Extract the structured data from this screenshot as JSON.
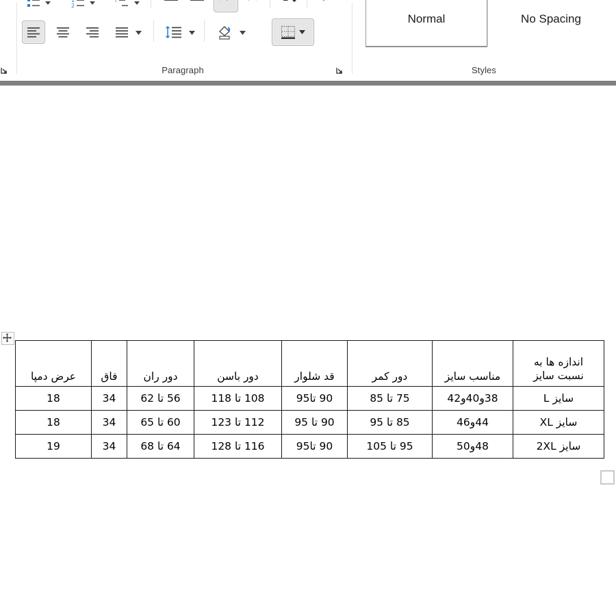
{
  "app": {
    "name": "Microsoft Word",
    "document_area_background": "#808080",
    "page_background": "#ffffff"
  },
  "ribbon": {
    "groups": [
      {
        "id": "paragraph",
        "label": "Paragraph",
        "dialog_launcher_name": "paragraph-dialog-launcher",
        "controls_row1": [
          {
            "id": "bullets",
            "name": "bullets-icon",
            "tooltip": "Bullets"
          },
          {
            "id": "numbering",
            "name": "numbering-icon",
            "tooltip": "Numbering"
          },
          {
            "id": "multilevel",
            "name": "multilevel-list-icon",
            "tooltip": "Multilevel List"
          },
          {
            "id": "decrease-indent",
            "name": "decrease-indent-icon",
            "tooltip": "Decrease Indent"
          },
          {
            "id": "increase-indent",
            "name": "increase-indent-icon",
            "tooltip": "Increase Indent"
          },
          {
            "id": "rtl-text",
            "name": "right-to-left-text-direction-icon",
            "tooltip": "Right-to-Left Text Direction",
            "selected": true
          },
          {
            "id": "ltr-text",
            "name": "left-to-right-text-direction-icon",
            "tooltip": "Left-to-Right Text Direction"
          },
          {
            "id": "sort",
            "name": "sort-icon",
            "tooltip": "Sort"
          },
          {
            "id": "show-marks",
            "name": "show-formatting-marks-icon",
            "tooltip": "Show/Hide ¶"
          }
        ],
        "controls_row2": [
          {
            "id": "align-left",
            "name": "align-left-icon",
            "tooltip": "Align Left",
            "selected": true
          },
          {
            "id": "align-center",
            "name": "align-center-icon",
            "tooltip": "Center"
          },
          {
            "id": "align-right",
            "name": "align-right-icon",
            "tooltip": "Align Right"
          },
          {
            "id": "justify",
            "name": "justify-icon",
            "tooltip": "Justify"
          },
          {
            "id": "line-spacing",
            "name": "line-spacing-icon",
            "tooltip": "Line and Paragraph Spacing"
          },
          {
            "id": "shading",
            "name": "shading-icon",
            "tooltip": "Shading"
          },
          {
            "id": "borders",
            "name": "borders-icon",
            "tooltip": "Borders"
          }
        ]
      },
      {
        "id": "styles",
        "label": "Styles",
        "dialog_launcher_name": "styles-dialog-launcher",
        "gallery": [
          {
            "id": "normal",
            "label": "Normal",
            "active": true
          },
          {
            "id": "no-spacing",
            "label": "No Spacing",
            "active": false
          }
        ]
      }
    ],
    "accent_color": "#2b7cd3",
    "icon_color": "#414141"
  },
  "document": {
    "table_move_handle_name": "table-move-handle",
    "table_resize_handle_name": "table-resize-handle",
    "size_table": {
      "direction": "rtl",
      "headers": [
        "اندازه ها به نسبت سایز",
        "مناسب سایز",
        "دور کمر",
        "قد شلوار",
        "دور باسن",
        "دور ران",
        "فاق",
        "عرض دمپا"
      ],
      "header_lines": [
        [
          "اندازه ها به",
          "نسبت سایز"
        ],
        [
          "مناسب سایز"
        ],
        [
          "دور کمر"
        ],
        [
          "قد شلوار"
        ],
        [
          "دور باسن"
        ],
        [
          "دور ران"
        ],
        [
          "فاق"
        ],
        [
          "عرض دمپا"
        ]
      ],
      "rows": [
        {
          "size": "سایز    L",
          "suitable_size": "38و40و42",
          "waist": "75 تا 85",
          "length": "90 تا95",
          "hip": "108 تا 118",
          "thigh": "56 تا 62",
          "rise": "34",
          "hem_width": "18"
        },
        {
          "size": "سایز    XL",
          "suitable_size": "44و46",
          "waist": "85 تا 95",
          "length": "90 تا 95",
          "hip": "112 تا 123",
          "thigh": "60 تا 65",
          "rise": "34",
          "hem_width": "18"
        },
        {
          "size": "سایز 2XL",
          "suitable_size": "48و50",
          "waist": "95 تا 105",
          "length": "90 تا95",
          "hip": "116 تا 128",
          "thigh": "64 تا 68",
          "rise": "34",
          "hem_width": "19"
        }
      ]
    }
  }
}
